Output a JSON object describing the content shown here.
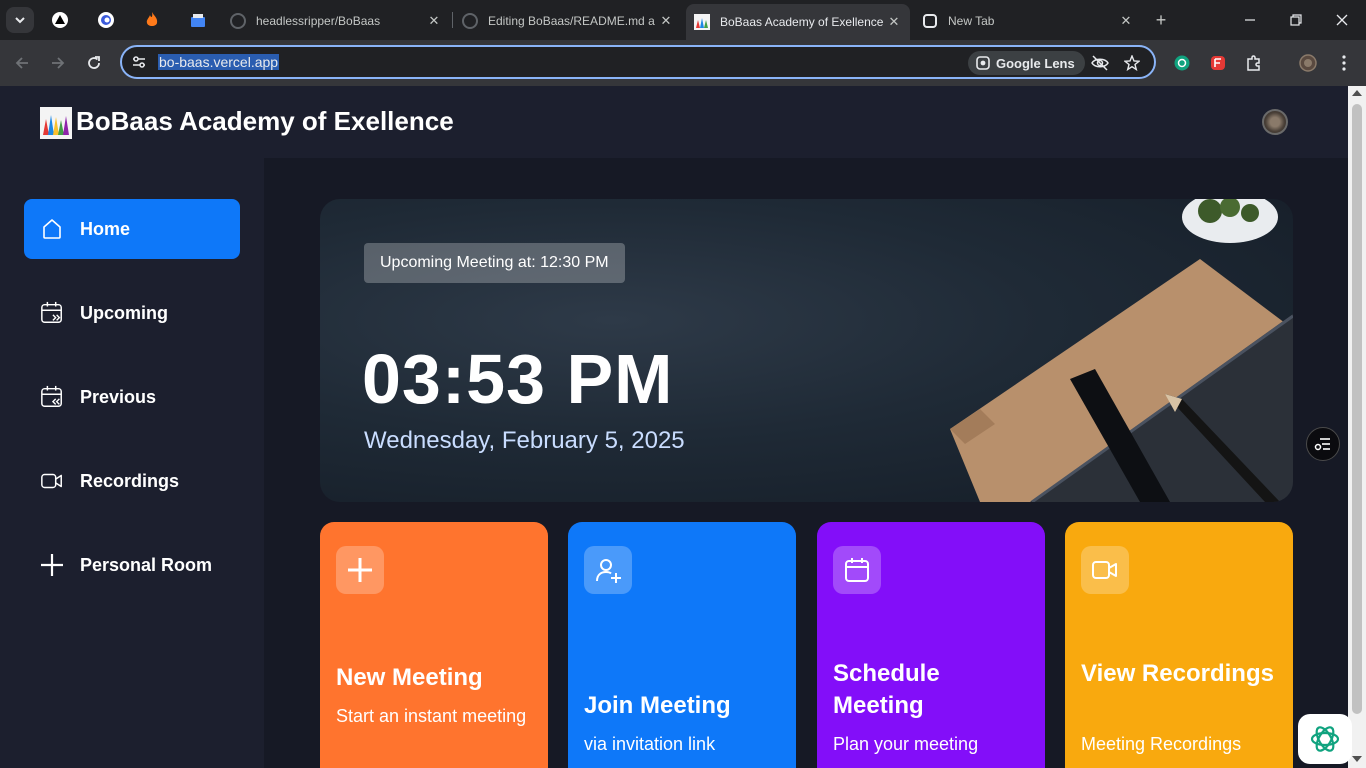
{
  "browser": {
    "tabs": [
      {
        "title": "headlessripper/BoBaas",
        "icon": "github-icon"
      },
      {
        "title": "Editing BoBaas/README.md a",
        "icon": "github-icon"
      },
      {
        "title": "BoBaas Academy of Exellence",
        "icon": "site-logo-icon",
        "active": true
      },
      {
        "title": "New Tab",
        "icon": "new-tab-icon"
      }
    ],
    "url": "bo-baas.vercel.app",
    "lens_label": "Google Lens"
  },
  "app": {
    "title": "BoBaas Academy of Exellence",
    "colors": {
      "active": "#0e78f9",
      "orange": "#ff742e",
      "blue": "#0e78f9",
      "purple": "#830ef9",
      "yellow": "#f9a90e"
    }
  },
  "sidebar": {
    "items": [
      {
        "label": "Home",
        "icon": "home-icon"
      },
      {
        "label": "Upcoming",
        "icon": "calendar-forward-icon"
      },
      {
        "label": "Previous",
        "icon": "calendar-back-icon"
      },
      {
        "label": "Recordings",
        "icon": "video-icon"
      },
      {
        "label": "Personal Room",
        "icon": "plus-icon"
      }
    ]
  },
  "hero": {
    "upcoming": "Upcoming Meeting at: 12:30 PM",
    "time": "03:53 PM",
    "date": "Wednesday, February 5, 2025"
  },
  "cards": [
    {
      "title": "New Meeting",
      "subtitle": "Start an instant meeting",
      "icon": "plus-icon"
    },
    {
      "title": "Join Meeting",
      "subtitle": "via invitation link",
      "icon": "add-user-icon"
    },
    {
      "title": "Schedule Meeting",
      "subtitle": "Plan your meeting",
      "icon": "calendar-icon"
    },
    {
      "title": "View Recordings",
      "subtitle": "Meeting Recordings",
      "icon": "video-icon"
    }
  ]
}
